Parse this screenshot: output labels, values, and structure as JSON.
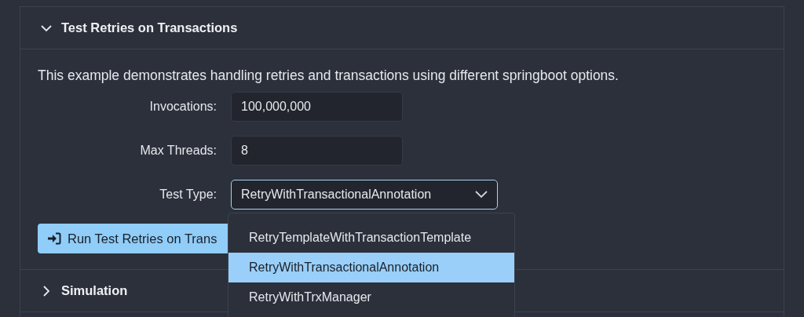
{
  "sections": [
    {
      "title": "Test Retries on Transactions",
      "expanded": true
    },
    {
      "title": "Simulation",
      "expanded": false
    }
  ],
  "description": "This example demonstrates handling retries and transactions using different springboot options.",
  "fields": [
    {
      "kind": "input",
      "label": "Invocations:",
      "value": "100,000,000"
    },
    {
      "kind": "input",
      "label": "Max Threads:",
      "value": "8"
    },
    {
      "kind": "select",
      "label": "Test Type:",
      "value": "RetryWithTransactionalAnnotation",
      "expanded": true
    }
  ],
  "run_button": "Run Test Retries on Trans",
  "dropdown_options": [
    {
      "label": "RetryTemplateWithTransactionTemplate",
      "selected": false
    },
    {
      "label": "RetryWithTransactionalAnnotation",
      "selected": true
    },
    {
      "label": "RetryWithTrxManager",
      "selected": false
    }
  ]
}
